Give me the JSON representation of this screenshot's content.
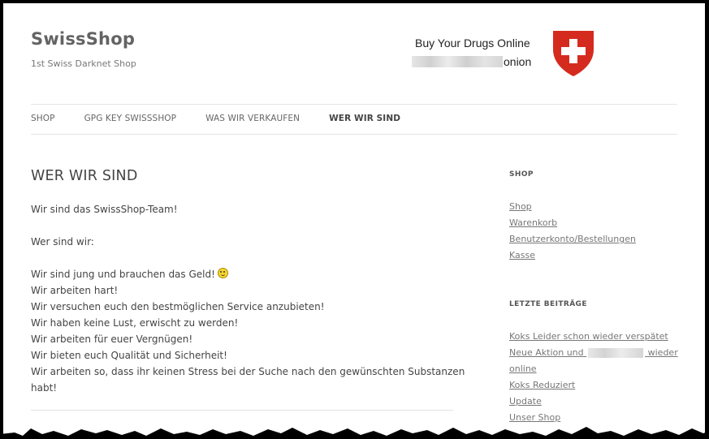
{
  "header": {
    "site_title": "SwissShop",
    "site_description": "1st Swiss Darknet Shop",
    "promo_line1": "Buy Your Drugs Online",
    "promo_line2_suffix": "onion",
    "flag_icon": "swiss-shield-icon",
    "flag_color": "#d52b1e"
  },
  "nav": {
    "items": [
      {
        "label": "SHOP"
      },
      {
        "label": "GPG KEY SWISSSHOP"
      },
      {
        "label": "WAS WIR VERKAUFEN"
      },
      {
        "label": "WER WIR SIND"
      }
    ],
    "active_index": 3
  },
  "main": {
    "title": "WER WIR SIND",
    "intro": "Wir sind das SwissShop-Team!",
    "question": "Wer sind wir:",
    "lines": [
      "Wir sind jung und brauchen das Geld!",
      "Wir arbeiten hart!",
      "Wir versuchen euch den bestmöglichen Service anzubieten!",
      "Wir haben keine Lust, erwischt zu werden!",
      "Wir arbeiten für euer Vergnügen!",
      "Wir bieten euch Qualität und Sicherheit!",
      "Wir arbeiten so, dass ihr keinen Stress bei der Suche nach den gewünschten Substanzen habt!"
    ],
    "emoji_icon": "smiley-icon"
  },
  "sidebar": {
    "shop_widget": {
      "title": "SHOP",
      "links": [
        "Shop",
        "Warenkorb",
        "Benutzerkonto/Bestellungen",
        "Kasse"
      ]
    },
    "recent_widget": {
      "title": "LETZTE BEITRÄGE",
      "link1": "Koks Leider schon wieder verspätet",
      "link2_prefix": "Neue Aktion und",
      "link2_suffix": "wieder",
      "link2_line2": "online",
      "link3": "Koks Reduziert",
      "link4": "Update",
      "link5": "Unser Shop"
    }
  }
}
